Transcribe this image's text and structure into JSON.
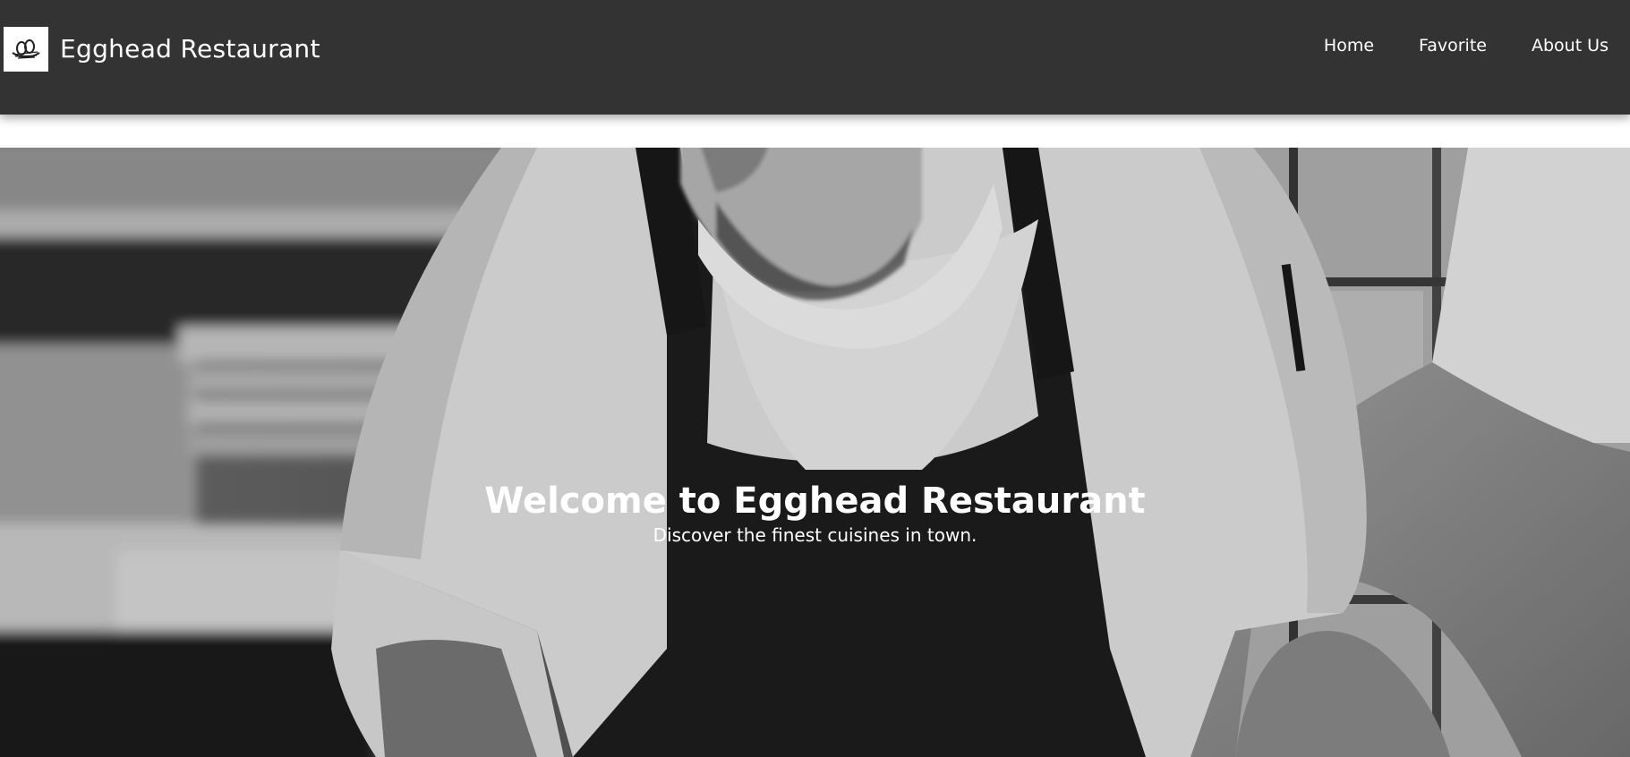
{
  "navbar": {
    "brand_name": "Egghead Restaurant",
    "logo_icon": "egg-nest-icon",
    "links": [
      {
        "label": "Home"
      },
      {
        "label": "Favorite"
      },
      {
        "label": "About Us"
      }
    ]
  },
  "hero": {
    "title": "Welcome to Egghead Restaurant",
    "subtitle": "Discover the finest cuisines in town.",
    "image_subject": "chef-in-kitchen-photo"
  },
  "colors": {
    "navbar_bg": "#333333",
    "nav_text": "#ffffff",
    "page_bg": "#ffffff"
  }
}
